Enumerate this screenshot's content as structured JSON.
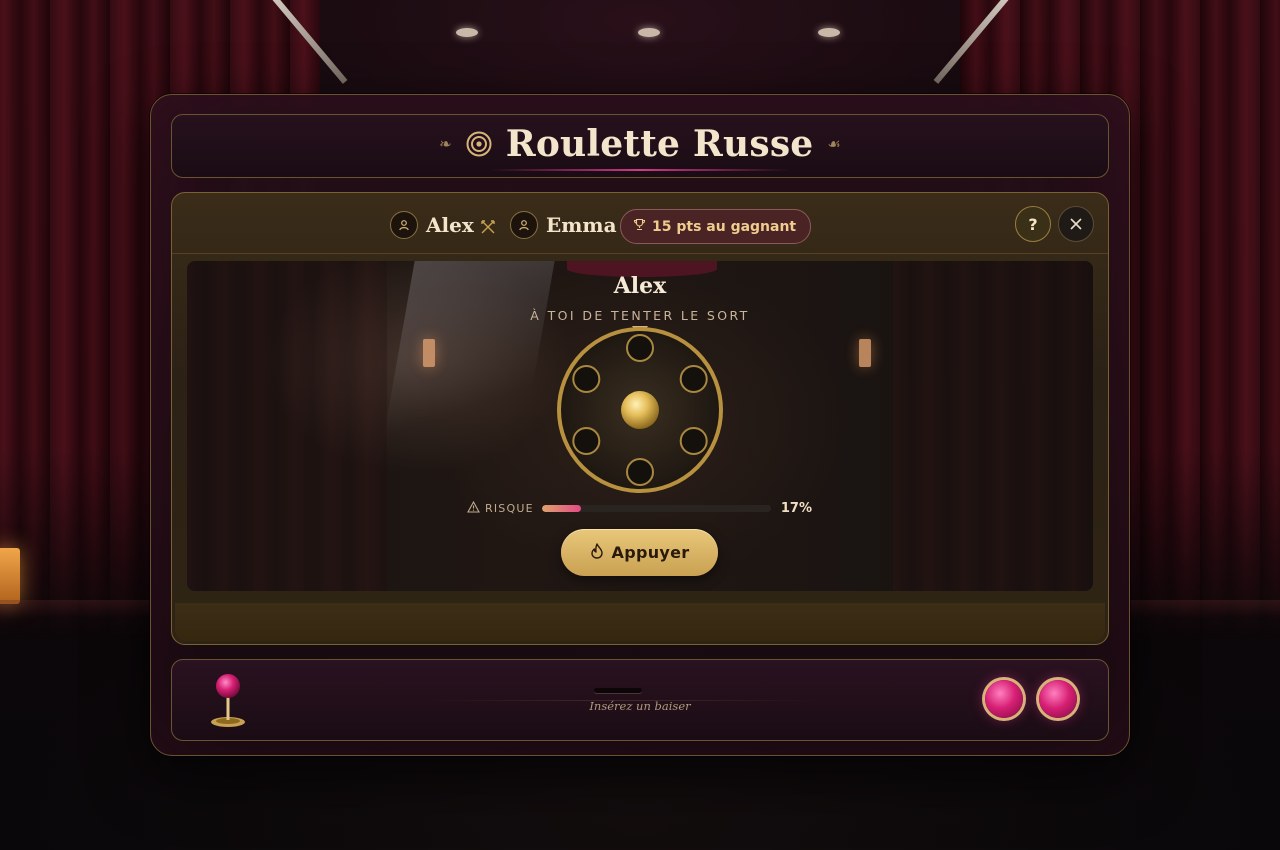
{
  "header": {
    "title": "Roulette Russe",
    "fleuron_left": "❧",
    "fleuron_right": "☙"
  },
  "match": {
    "player1": "Alex",
    "player2": "Emma",
    "prize_label": "15 pts au gagnant",
    "help_label": "?"
  },
  "turn": {
    "current_player": "Alex",
    "prompt": "À TOI DE TENTER LE SORT"
  },
  "cylinder": {
    "chambers": 6,
    "highlighted_chamber": "center"
  },
  "risk": {
    "label": "RISQUE",
    "percent_label": "17%",
    "value": 0.17
  },
  "actions": {
    "press_label": "Appuyer"
  },
  "footer": {
    "insert_label": "Insérez un baiser",
    "tokens": 2
  },
  "colors": {
    "gold": "#d7b37a",
    "magenta": "#d61f74",
    "cream": "#f3e4cc"
  }
}
